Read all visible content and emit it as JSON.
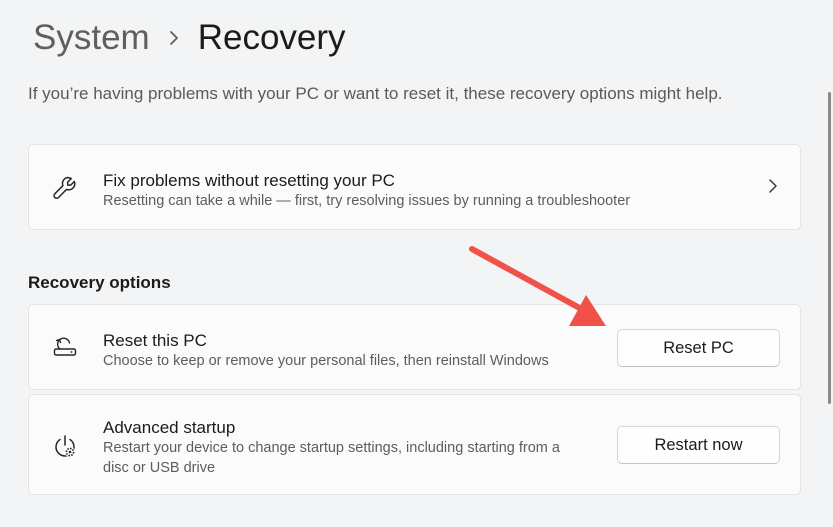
{
  "breadcrumb": {
    "parent": "System",
    "current": "Recovery"
  },
  "intro_text": "If you’re having problems with your PC or want to reset it, these recovery options might help.",
  "fix_problems": {
    "icon": "wrench-icon",
    "title": "Fix problems without resetting your PC",
    "description": "Resetting can take a while — first, try resolving issues by running a troubleshooter"
  },
  "recovery_options": {
    "heading": "Recovery options",
    "reset": {
      "icon": "reset-pc-icon",
      "title": "Reset this PC",
      "description": "Choose to keep or remove your personal files, then reinstall Windows",
      "button_label": "Reset PC"
    },
    "advanced_startup": {
      "icon": "power-gear-icon",
      "title": "Advanced startup",
      "description_line1": "Restart your device to change startup settings, including starting from a",
      "description_line2": "disc or USB drive",
      "button_label": "Restart now"
    }
  },
  "colors": {
    "background": "#f3f4f5",
    "card": "#fbfbfb",
    "annotation_arrow": "#f0524a"
  }
}
